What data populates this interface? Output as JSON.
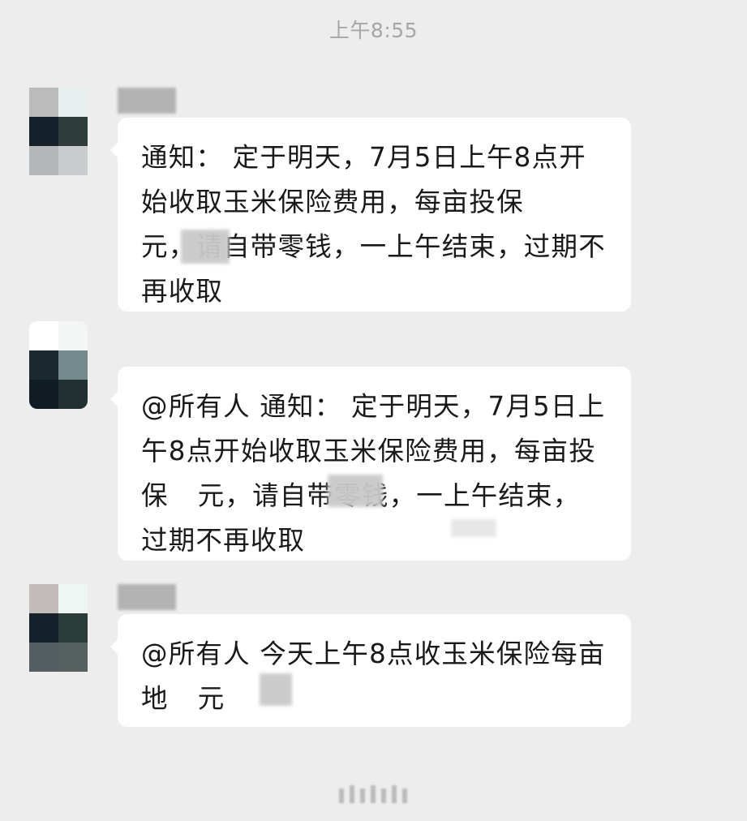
{
  "header": {
    "timestamp": "上午8:55"
  },
  "messages": [
    {
      "sender_name_redacted": true,
      "text": "通知： 定于明天，7月5日上午8点开始收取玉米保险费用，每亩投保",
      "text_after_redaction": "元，请自带零钱，一上午结束，过期不再收取"
    },
    {
      "sender_name_redacted": true,
      "text": "@所有人  通知： 定于明天，7月5日上午8点开始收取玉米保险费用，每亩投保",
      "text_after_redaction": "元，请自带零钱，一上午结束，过期不再收取"
    },
    {
      "sender_name_redacted": true,
      "text": "@所有人  今天上午8点收玉米保险每亩地",
      "text_after_redaction": "元"
    }
  ],
  "colors": {
    "background": "#ededed",
    "bubble": "#ffffff",
    "text": "#191919",
    "timestamp": "#a6a6a6"
  }
}
